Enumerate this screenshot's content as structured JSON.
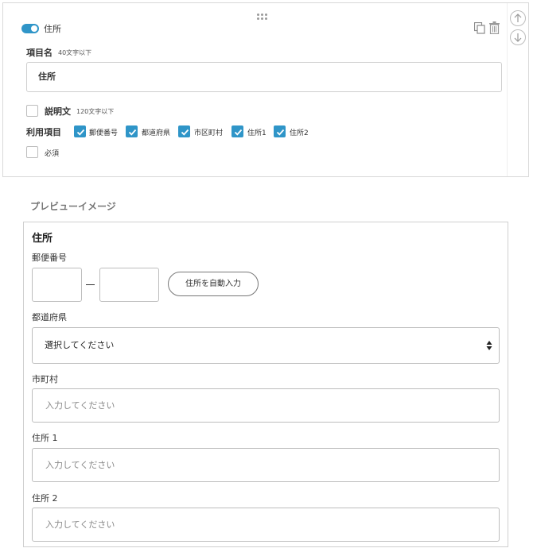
{
  "editor": {
    "field_title": "住所",
    "item_name": {
      "label": "項目名",
      "hint": "40文字以下",
      "value": "住所"
    },
    "description": {
      "label": "説明文",
      "hint": "120文字以下",
      "checked": false
    },
    "usage": {
      "label": "利用項目",
      "options": [
        {
          "label": "郵便番号",
          "checked": true
        },
        {
          "label": "都道府県",
          "checked": true
        },
        {
          "label": "市区町村",
          "checked": true
        },
        {
          "label": "住所1",
          "checked": true
        },
        {
          "label": "住所2",
          "checked": true
        }
      ]
    },
    "required": {
      "label": "必須",
      "checked": false
    },
    "accent_color": "#2f95c8",
    "icons": [
      "drag-handle-icon",
      "copy-icon",
      "trash-icon",
      "arrow-up-icon",
      "arrow-down-icon"
    ]
  },
  "preview": {
    "heading": "プレビューイメージ",
    "title": "住所",
    "postal": {
      "label": "郵便番号",
      "button": "住所を自動入力"
    },
    "prefecture": {
      "label": "都道府県",
      "selected": "選択してください"
    },
    "city": {
      "label": "市町村",
      "placeholder": "入力してください"
    },
    "address1": {
      "label": "住所 1",
      "placeholder": "入力してください"
    },
    "address2": {
      "label": "住所 2",
      "placeholder": "入力してください"
    }
  }
}
